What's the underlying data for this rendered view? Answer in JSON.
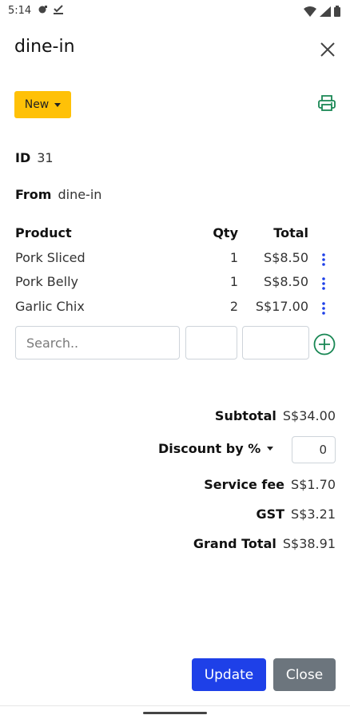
{
  "statusbar": {
    "time": "5:14"
  },
  "header": {
    "title": "dine-in"
  },
  "order": {
    "status_label": "New",
    "id_label": "ID",
    "id_value": "31",
    "from_label": "From",
    "from_value": "dine-in"
  },
  "table": {
    "headers": {
      "product": "Product",
      "qty": "Qty",
      "total": "Total"
    },
    "rows": [
      {
        "product": "Pork Sliced",
        "qty": "1",
        "total": "S$8.50"
      },
      {
        "product": "Pork Belly",
        "qty": "1",
        "total": "S$8.50"
      },
      {
        "product": "Garlic Chix",
        "qty": "2",
        "total": "S$17.00"
      }
    ]
  },
  "add_row": {
    "search_placeholder": "Search..",
    "qty_value": "",
    "price_value": ""
  },
  "summary": {
    "subtotal_label": "Subtotal",
    "subtotal_value": "S$34.00",
    "discount_label": "Discount by %",
    "discount_value": "0",
    "service_label": "Service fee",
    "service_value": "S$1.70",
    "gst_label": "GST",
    "gst_value": "S$3.21",
    "grand_label": "Grand Total",
    "grand_value": "S$38.91"
  },
  "actions": {
    "update_label": "Update",
    "close_label": "Close"
  },
  "colors": {
    "status": "#ffc107",
    "primary": "#1e40e8",
    "secondary": "#6c757d",
    "success": "#198754",
    "kebab": "#1e40e8"
  }
}
